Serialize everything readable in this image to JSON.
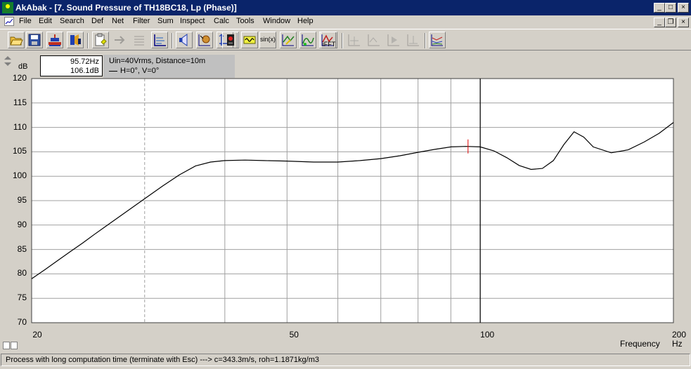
{
  "window": {
    "title": "AkAbak - [7. Sound Pressure of TH18BC18, Lp (Phase)]",
    "title_color": "#0a246a"
  },
  "menu": {
    "items": [
      "File",
      "Edit",
      "Search",
      "Def",
      "Net",
      "Filter",
      "Sum",
      "Inspect",
      "Calc",
      "Tools",
      "Window",
      "Help"
    ]
  },
  "toolbar": {
    "buttons": [
      {
        "icon": "open-folder-icon",
        "enabled": true
      },
      {
        "icon": "save-disk-icon",
        "enabled": true
      },
      {
        "icon": "network-icon",
        "enabled": true
      },
      {
        "icon": "driver-icon",
        "enabled": true
      },
      {
        "icon": "clipboard-icon",
        "enabled": true
      },
      {
        "icon": "arrow-right-icon",
        "enabled": false
      },
      {
        "icon": "lines-icon",
        "enabled": false
      },
      {
        "icon": "axes-icon",
        "enabled": true
      },
      {
        "icon": "speaker-icon",
        "enabled": true
      },
      {
        "icon": "directivity-icon",
        "enabled": true
      },
      {
        "icon": "axes-arrows-icon",
        "enabled": true
      },
      {
        "icon": "record-icon",
        "enabled": true
      },
      {
        "icon": "signal-generator-icon",
        "enabled": true
      },
      {
        "icon": "sine-icon",
        "label": "sin(x)",
        "enabled": true
      },
      {
        "icon": "transfer-icon",
        "enabled": true
      },
      {
        "icon": "step-response-icon",
        "enabled": true
      },
      {
        "icon": "phase-icon",
        "enabled": true
      },
      {
        "icon": "ifft-icon",
        "label": "iFFT",
        "enabled": true
      },
      {
        "icon": "disabled-plot-icon",
        "enabled": false
      },
      {
        "icon": "disabled-plot-icon",
        "enabled": false
      },
      {
        "icon": "disabled-plot-icon",
        "enabled": false
      },
      {
        "icon": "disabled-plot-icon",
        "enabled": false
      },
      {
        "icon": "multi-plot-icon",
        "enabled": true
      }
    ]
  },
  "cursor": {
    "frequency": "95.72Hz",
    "level": "106.1dB"
  },
  "legend": {
    "info": "Uin=40Vrms, Distance=10m",
    "series": "H=0°, V=0°"
  },
  "status": "Process with long computation time (terminate with Esc) ---> c=343.3m/s, roh=1.1871kg/m3",
  "chart_data": {
    "type": "line",
    "xlabel": "Frequency",
    "xunit": "Hz",
    "ylabel": "dB",
    "xscale": "log",
    "xlim": [
      20,
      200
    ],
    "ylim": [
      70,
      120
    ],
    "yticks": [
      70,
      75,
      80,
      85,
      90,
      95,
      100,
      105,
      110,
      115,
      120
    ],
    "xtick_labels": [
      {
        "value": 20,
        "label": "20"
      },
      {
        "value": 50,
        "label": "50"
      },
      {
        "value": 100,
        "label": "100"
      },
      {
        "value": 200,
        "label": "200"
      }
    ],
    "grid": true,
    "cursor_x": 95.72,
    "cursor_y": 106.1,
    "series": [
      {
        "color": "#000000",
        "x": [
          20,
          21,
          22,
          23,
          24,
          25,
          26,
          28,
          30,
          32,
          34,
          36,
          38,
          40,
          43,
          46,
          50,
          55,
          60,
          65,
          70,
          75,
          80,
          85,
          90,
          95,
          100,
          105,
          110,
          115,
          120,
          125,
          130,
          135,
          140,
          145,
          150,
          160,
          170,
          180,
          190,
          200
        ],
        "y": [
          79,
          80.9,
          82.8,
          84.6,
          86.3,
          88,
          89.6,
          92.6,
          95.4,
          98,
          100.3,
          102.1,
          102.9,
          103.2,
          103.3,
          103.2,
          103.1,
          102.9,
          102.9,
          103.2,
          103.6,
          104.2,
          104.9,
          105.5,
          106,
          106.1,
          106,
          105.2,
          103.8,
          102.2,
          101.4,
          101.6,
          103.2,
          106.5,
          109.1,
          108,
          106,
          104.8,
          105.4,
          107,
          108.8,
          111
        ]
      }
    ]
  }
}
